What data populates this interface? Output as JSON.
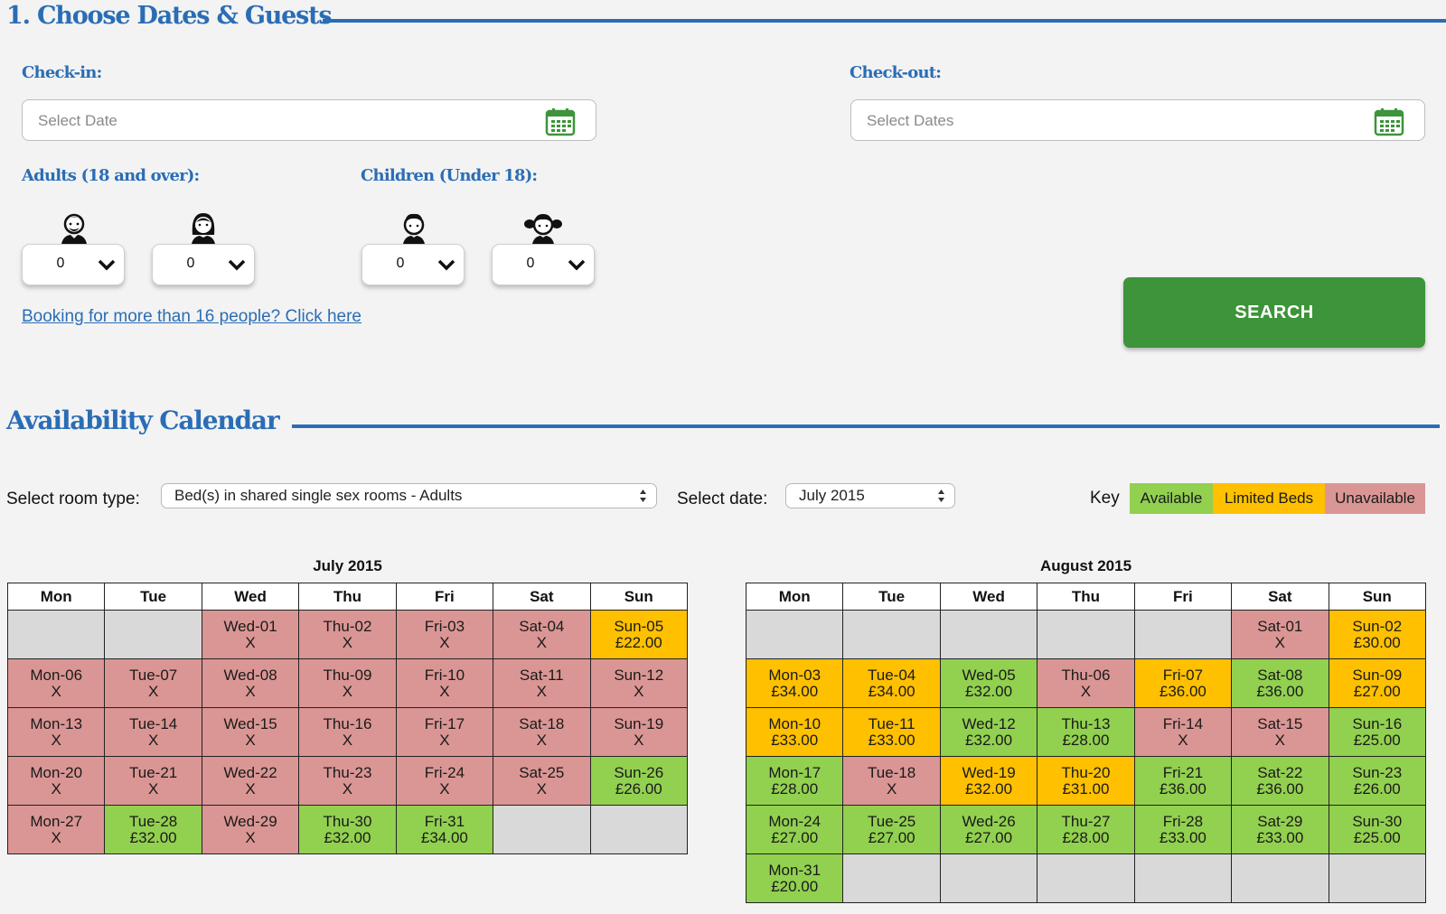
{
  "section1": {
    "title": "1. Choose Dates & Guests"
  },
  "checkin": {
    "label": "Check-in:",
    "placeholder": "Select Date"
  },
  "checkout": {
    "label": "Check-out:",
    "placeholder": "Select Dates"
  },
  "adults": {
    "label": "Adults (18 and over):",
    "male_value": "0",
    "female_value": "0"
  },
  "children": {
    "label": "Children (Under 18):",
    "boy_value": "0",
    "girl_value": "0"
  },
  "group_link": "Booking for more than 16 people? Click here",
  "search_button": "SEARCH",
  "calendar_section": {
    "title": "Availability Calendar"
  },
  "room_type": {
    "label": "Select room type:",
    "value": "Bed(s) in shared single sex rooms - Adults"
  },
  "date_select": {
    "label": "Select date:",
    "value": "July 2015"
  },
  "key": {
    "label": "Key",
    "available": "Available",
    "limited": "Limited Beds",
    "unavailable": "Unavailable",
    "colors": {
      "available": "#92d050",
      "limited": "#ffc000",
      "unavailable": "#da9694",
      "empty": "#d9d9d9"
    }
  },
  "weekdays": [
    "Mon",
    "Tue",
    "Wed",
    "Thu",
    "Fri",
    "Sat",
    "Sun"
  ],
  "months": [
    {
      "title": "July 2015",
      "weeks": [
        [
          {
            "s": "empty",
            "d": "",
            "p": ""
          },
          {
            "s": "empty",
            "d": "",
            "p": ""
          },
          {
            "s": "unavail",
            "d": "Wed-01",
            "p": "X"
          },
          {
            "s": "unavail",
            "d": "Thu-02",
            "p": "X"
          },
          {
            "s": "unavail",
            "d": "Fri-03",
            "p": "X"
          },
          {
            "s": "unavail",
            "d": "Sat-04",
            "p": "X"
          },
          {
            "s": "limited",
            "d": "Sun-05",
            "p": "£22.00"
          }
        ],
        [
          {
            "s": "unavail",
            "d": "Mon-06",
            "p": "X"
          },
          {
            "s": "unavail",
            "d": "Tue-07",
            "p": "X"
          },
          {
            "s": "unavail",
            "d": "Wed-08",
            "p": "X"
          },
          {
            "s": "unavail",
            "d": "Thu-09",
            "p": "X"
          },
          {
            "s": "unavail",
            "d": "Fri-10",
            "p": "X"
          },
          {
            "s": "unavail",
            "d": "Sat-11",
            "p": "X"
          },
          {
            "s": "unavail",
            "d": "Sun-12",
            "p": "X"
          }
        ],
        [
          {
            "s": "unavail",
            "d": "Mon-13",
            "p": "X"
          },
          {
            "s": "unavail",
            "d": "Tue-14",
            "p": "X"
          },
          {
            "s": "unavail",
            "d": "Wed-15",
            "p": "X"
          },
          {
            "s": "unavail",
            "d": "Thu-16",
            "p": "X"
          },
          {
            "s": "unavail",
            "d": "Fri-17",
            "p": "X"
          },
          {
            "s": "unavail",
            "d": "Sat-18",
            "p": "X"
          },
          {
            "s": "unavail",
            "d": "Sun-19",
            "p": "X"
          }
        ],
        [
          {
            "s": "unavail",
            "d": "Mon-20",
            "p": "X"
          },
          {
            "s": "unavail",
            "d": "Tue-21",
            "p": "X"
          },
          {
            "s": "unavail",
            "d": "Wed-22",
            "p": "X"
          },
          {
            "s": "unavail",
            "d": "Thu-23",
            "p": "X"
          },
          {
            "s": "unavail",
            "d": "Fri-24",
            "p": "X"
          },
          {
            "s": "unavail",
            "d": "Sat-25",
            "p": "X"
          },
          {
            "s": "avail",
            "d": "Sun-26",
            "p": "£26.00"
          }
        ],
        [
          {
            "s": "unavail",
            "d": "Mon-27",
            "p": "X"
          },
          {
            "s": "avail",
            "d": "Tue-28",
            "p": "£32.00"
          },
          {
            "s": "unavail",
            "d": "Wed-29",
            "p": "X"
          },
          {
            "s": "avail",
            "d": "Thu-30",
            "p": "£32.00"
          },
          {
            "s": "avail",
            "d": "Fri-31",
            "p": "£34.00"
          },
          {
            "s": "empty",
            "d": "",
            "p": ""
          },
          {
            "s": "empty",
            "d": "",
            "p": ""
          }
        ]
      ]
    },
    {
      "title": "August 2015",
      "weeks": [
        [
          {
            "s": "empty",
            "d": "",
            "p": ""
          },
          {
            "s": "empty",
            "d": "",
            "p": ""
          },
          {
            "s": "empty",
            "d": "",
            "p": ""
          },
          {
            "s": "empty",
            "d": "",
            "p": ""
          },
          {
            "s": "empty",
            "d": "",
            "p": ""
          },
          {
            "s": "unavail",
            "d": "Sat-01",
            "p": "X"
          },
          {
            "s": "limited",
            "d": "Sun-02",
            "p": "£30.00"
          }
        ],
        [
          {
            "s": "limited",
            "d": "Mon-03",
            "p": "£34.00"
          },
          {
            "s": "limited",
            "d": "Tue-04",
            "p": "£34.00"
          },
          {
            "s": "avail",
            "d": "Wed-05",
            "p": "£32.00"
          },
          {
            "s": "unavail",
            "d": "Thu-06",
            "p": "X"
          },
          {
            "s": "limited",
            "d": "Fri-07",
            "p": "£36.00"
          },
          {
            "s": "avail",
            "d": "Sat-08",
            "p": "£36.00"
          },
          {
            "s": "limited",
            "d": "Sun-09",
            "p": "£27.00"
          }
        ],
        [
          {
            "s": "limited",
            "d": "Mon-10",
            "p": "£33.00"
          },
          {
            "s": "limited",
            "d": "Tue-11",
            "p": "£33.00"
          },
          {
            "s": "avail",
            "d": "Wed-12",
            "p": "£32.00"
          },
          {
            "s": "avail",
            "d": "Thu-13",
            "p": "£28.00"
          },
          {
            "s": "unavail",
            "d": "Fri-14",
            "p": "X"
          },
          {
            "s": "unavail",
            "d": "Sat-15",
            "p": "X"
          },
          {
            "s": "avail",
            "d": "Sun-16",
            "p": "£25.00"
          }
        ],
        [
          {
            "s": "avail",
            "d": "Mon-17",
            "p": "£28.00"
          },
          {
            "s": "unavail",
            "d": "Tue-18",
            "p": "X"
          },
          {
            "s": "limited",
            "d": "Wed-19",
            "p": "£32.00"
          },
          {
            "s": "limited",
            "d": "Thu-20",
            "p": "£31.00"
          },
          {
            "s": "avail",
            "d": "Fri-21",
            "p": "£36.00"
          },
          {
            "s": "avail",
            "d": "Sat-22",
            "p": "£36.00"
          },
          {
            "s": "avail",
            "d": "Sun-23",
            "p": "£26.00"
          }
        ],
        [
          {
            "s": "avail",
            "d": "Mon-24",
            "p": "£27.00"
          },
          {
            "s": "avail",
            "d": "Tue-25",
            "p": "£27.00"
          },
          {
            "s": "avail",
            "d": "Wed-26",
            "p": "£27.00"
          },
          {
            "s": "avail",
            "d": "Thu-27",
            "p": "£28.00"
          },
          {
            "s": "avail",
            "d": "Fri-28",
            "p": "£33.00"
          },
          {
            "s": "avail",
            "d": "Sat-29",
            "p": "£33.00"
          },
          {
            "s": "avail",
            "d": "Sun-30",
            "p": "£25.00"
          }
        ],
        [
          {
            "s": "avail",
            "d": "Mon-31",
            "p": "£20.00"
          },
          {
            "s": "empty",
            "d": "",
            "p": ""
          },
          {
            "s": "empty",
            "d": "",
            "p": ""
          },
          {
            "s": "empty",
            "d": "",
            "p": ""
          },
          {
            "s": "empty",
            "d": "",
            "p": ""
          },
          {
            "s": "empty",
            "d": "",
            "p": ""
          },
          {
            "s": "empty",
            "d": "",
            "p": ""
          }
        ]
      ]
    }
  ]
}
